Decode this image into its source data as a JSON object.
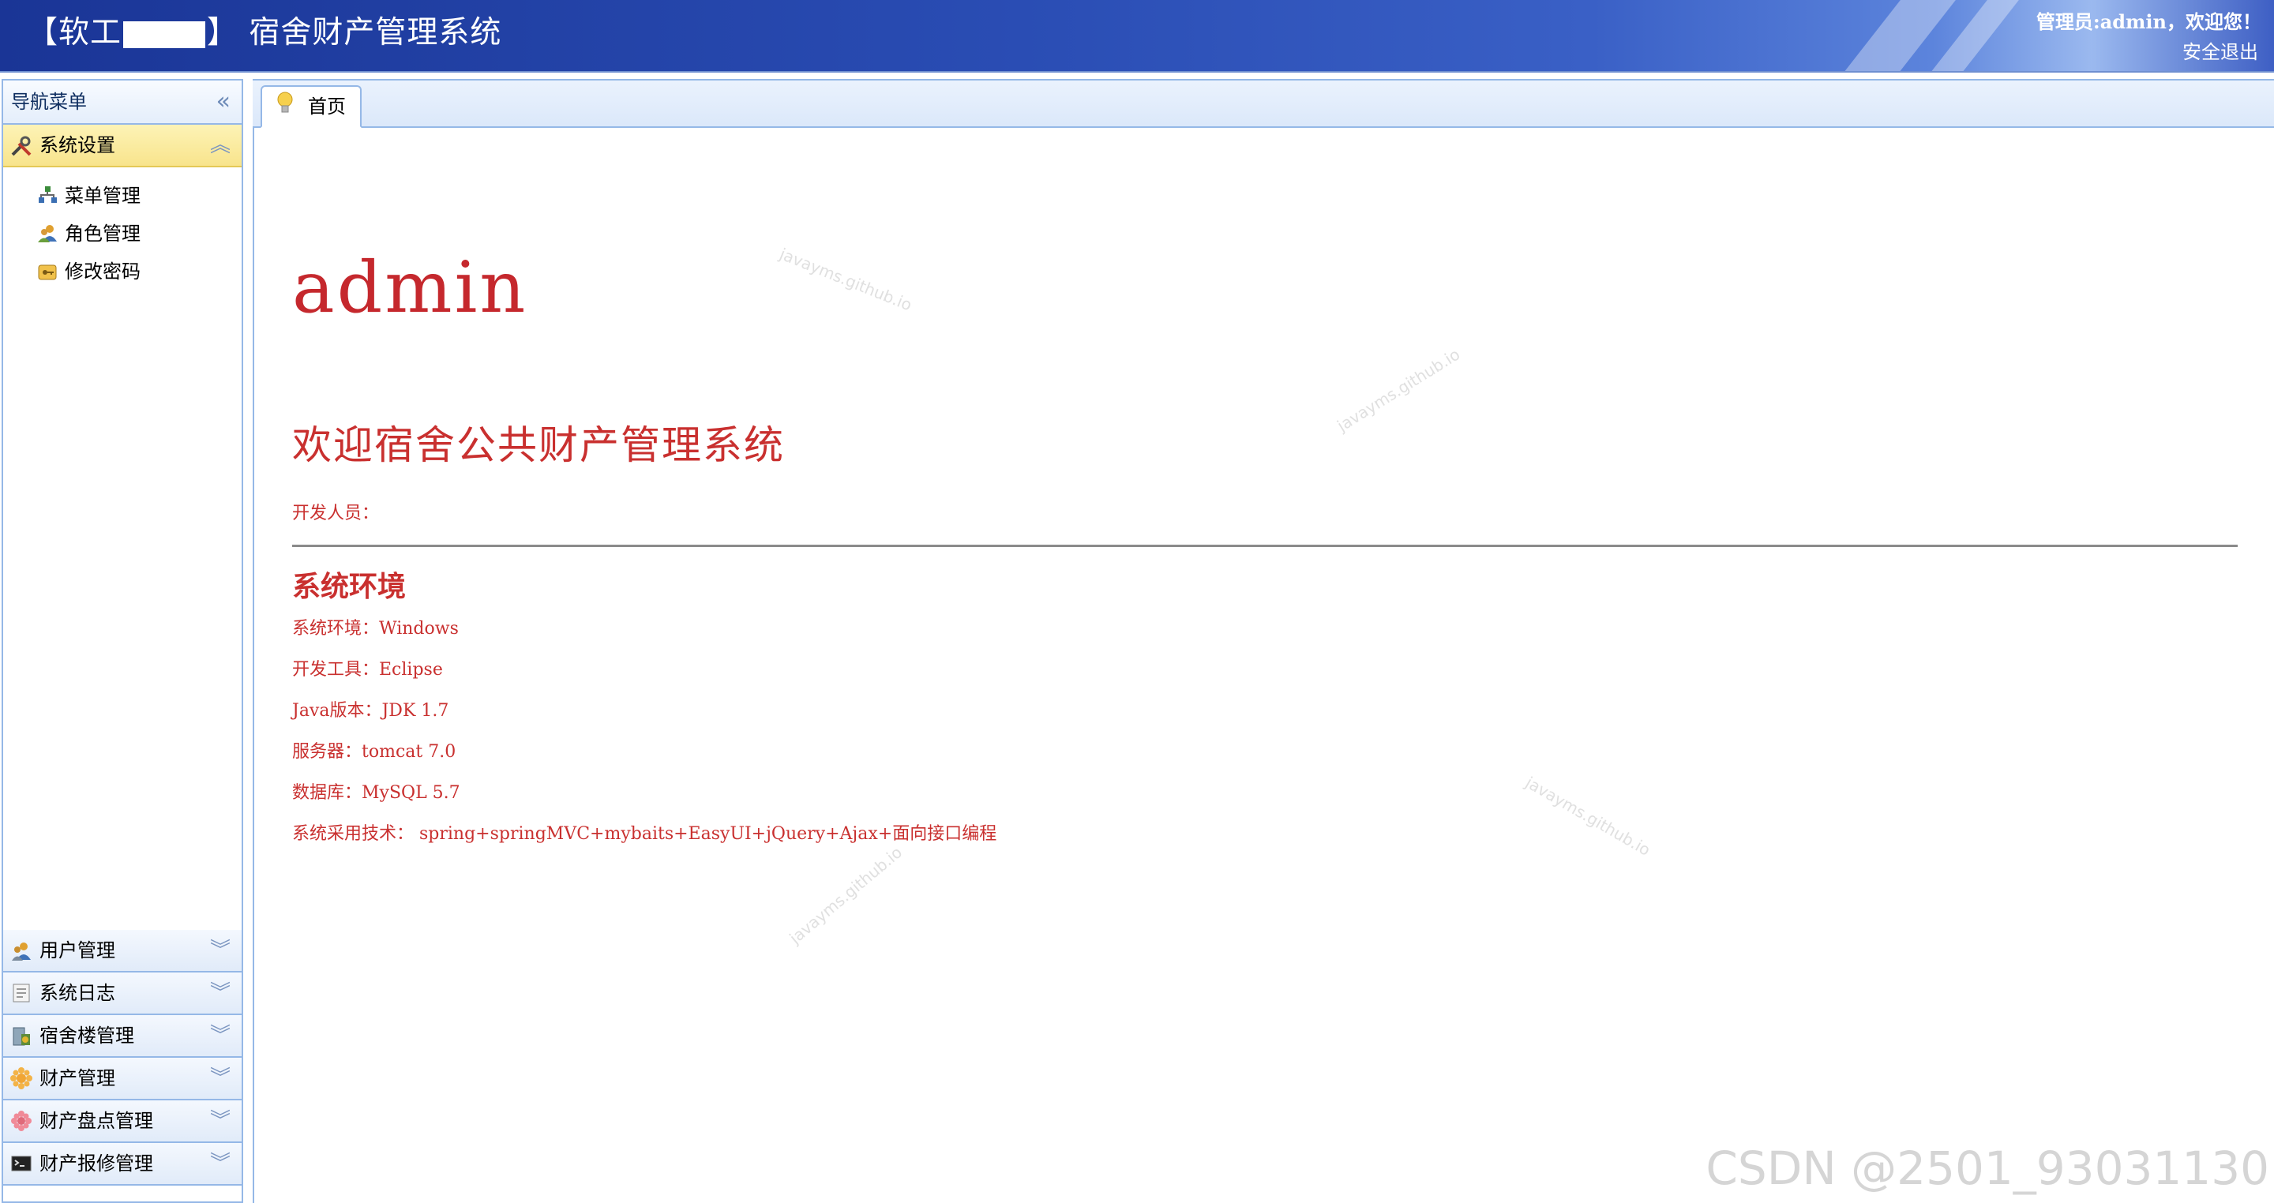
{
  "header": {
    "title_prefix": "【软工",
    "title_suffix": "】 宿舍财产管理系统",
    "admin_info": "管理员:admin，欢迎您！",
    "logout_label": "安全退出"
  },
  "sidebar": {
    "title": "导航菜单",
    "collapse_icon": "«",
    "active_panel": {
      "label": "系统设置",
      "icon": "tools-icon",
      "items": [
        {
          "label": "菜单管理",
          "icon": "sitemap-icon"
        },
        {
          "label": "角色管理",
          "icon": "users-icon"
        },
        {
          "label": "修改密码",
          "icon": "key-icon"
        }
      ]
    },
    "panels": [
      {
        "label": "用户管理",
        "icon": "user-icon"
      },
      {
        "label": "系统日志",
        "icon": "log-icon"
      },
      {
        "label": "宿舍楼管理",
        "icon": "building-icon"
      },
      {
        "label": "财产管理",
        "icon": "asset-icon"
      },
      {
        "label": "财产盘点管理",
        "icon": "inventory-icon"
      },
      {
        "label": "财产报修管理",
        "icon": "repair-icon"
      }
    ]
  },
  "tabs": [
    {
      "label": "首页",
      "icon": "bulb-icon"
    }
  ],
  "main": {
    "admin_name": "admin",
    "welcome": "欢迎宿舍公共财产管理系统",
    "developer_label": "开发人员：",
    "env_title": "系统环境",
    "env_lines": [
      "系统环境：Windows",
      "开发工具：Eclipse",
      "Java版本：JDK 1.7",
      "服务器：tomcat 7.0",
      "数据库：MySQL 5.7",
      "系统采用技术： spring+springMVC+mybaits+EasyUI+jQuery+Ajax+面向接口编程"
    ],
    "watermark": "javayms.github.io"
  },
  "footer": {
    "csdn_mark": "CSDN @2501_93031130"
  },
  "colors": {
    "accent_red": "#c9302f",
    "header_blue": "#2a4db4",
    "border_blue": "#95b8e7",
    "active_yellow": "#f8e48c"
  }
}
